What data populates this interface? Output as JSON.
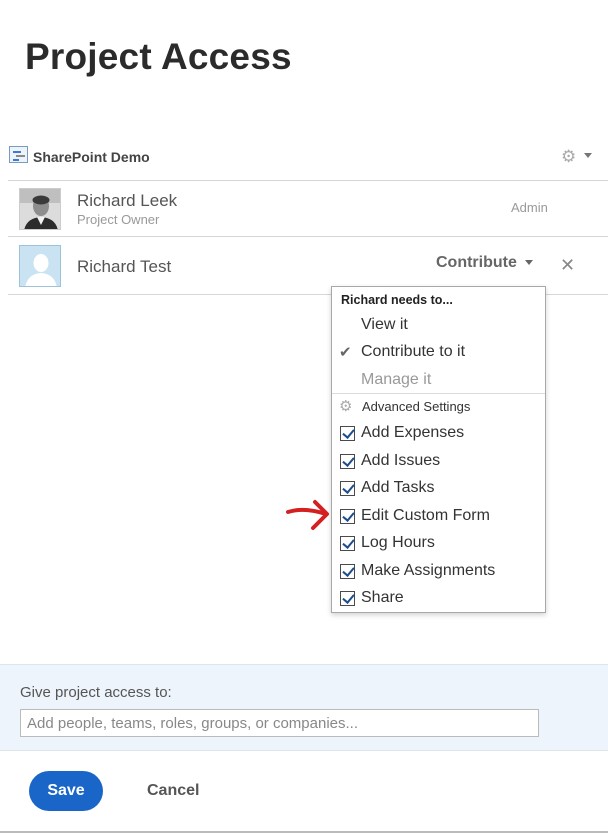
{
  "page": {
    "title": "Project Access"
  },
  "project": {
    "name": "SharePoint Demo"
  },
  "members": [
    {
      "name": "Richard Leek",
      "role": "Project Owner",
      "access": "Admin"
    },
    {
      "name": "Richard Test",
      "permission": "Contribute"
    }
  ],
  "permission_menu": {
    "header": "Richard needs to...",
    "options": [
      {
        "label": "View it",
        "selected": false,
        "disabled": false
      },
      {
        "label": "Contribute to it",
        "selected": true,
        "disabled": false
      },
      {
        "label": "Manage it",
        "selected": false,
        "disabled": true
      }
    ],
    "advanced_label": "Advanced Settings",
    "checkboxes": [
      {
        "label": "Add Expenses",
        "checked": true
      },
      {
        "label": "Add Issues",
        "checked": true
      },
      {
        "label": "Add Tasks",
        "checked": true
      },
      {
        "label": "Edit Custom Form",
        "checked": true
      },
      {
        "label": "Log Hours",
        "checked": true
      },
      {
        "label": "Make Assignments",
        "checked": true
      },
      {
        "label": "Share",
        "checked": true
      }
    ],
    "check_glyph": "✔"
  },
  "access": {
    "label": "Give project access to:",
    "placeholder": "Add people, teams, roles, groups, or companies..."
  },
  "buttons": {
    "save": "Save",
    "cancel": "Cancel"
  },
  "colors": {
    "primary": "#1966c8",
    "annotation_arrow": "#d42020"
  },
  "icons": {
    "gear": "gear-icon",
    "close": "close-icon",
    "caret": "caret-down-icon",
    "check": "checkmark-icon"
  }
}
